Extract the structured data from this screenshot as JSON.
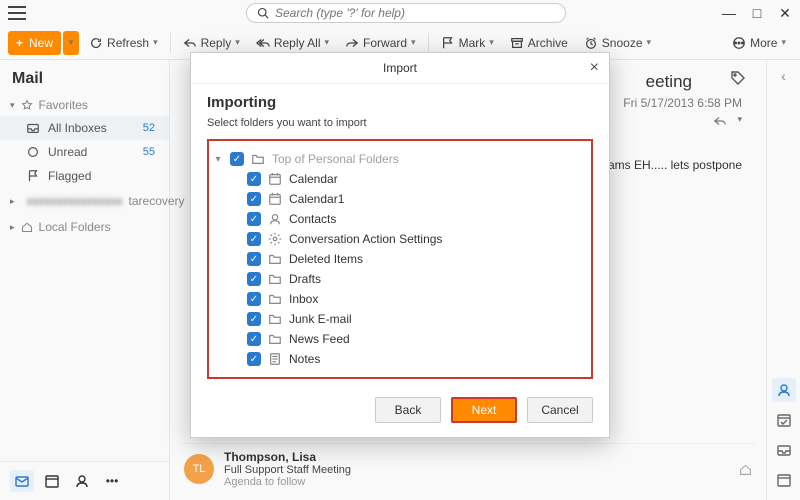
{
  "search": {
    "placeholder": "Search (type '?' for help)"
  },
  "toolbar": {
    "new": "New",
    "refresh": "Refresh",
    "reply": "Reply",
    "reply_all": "Reply All",
    "forward": "Forward",
    "mark": "Mark",
    "archive": "Archive",
    "snooze": "Snooze",
    "more": "More"
  },
  "sidebar": {
    "title": "Mail",
    "favorites": "Favorites",
    "items": [
      {
        "label": "All Inboxes",
        "count": "52"
      },
      {
        "label": "Unread",
        "count": "55"
      },
      {
        "label": "Flagged",
        "count": ""
      }
    ],
    "account_suffix": "tarecovery",
    "local_folders": "Local Folders"
  },
  "message": {
    "subject_suffix": "eeting",
    "date": "Fri 5/17/2013 6:58 PM",
    "body_snip": "ams EH..... lets postpone"
  },
  "listrow": {
    "initials": "TL",
    "from": "Thompson, Lisa",
    "subject": "Full Support Staff Meeting",
    "preview": "Agenda to follow"
  },
  "modal": {
    "title": "Import",
    "heading": "Importing",
    "sub": "Select folders you want to import",
    "root": "Top of Personal Folders",
    "folders": [
      {
        "label": "Calendar",
        "icon": "calendar"
      },
      {
        "label": "Calendar1",
        "icon": "calendar"
      },
      {
        "label": "Contacts",
        "icon": "contact"
      },
      {
        "label": "Conversation Action Settings",
        "icon": "gear"
      },
      {
        "label": "Deleted Items",
        "icon": "folder"
      },
      {
        "label": "Drafts",
        "icon": "folder"
      },
      {
        "label": "Inbox",
        "icon": "folder"
      },
      {
        "label": "Junk E-mail",
        "icon": "folder"
      },
      {
        "label": "News Feed",
        "icon": "folder"
      },
      {
        "label": "Notes",
        "icon": "note"
      }
    ],
    "back": "Back",
    "next": "Next",
    "cancel": "Cancel"
  }
}
